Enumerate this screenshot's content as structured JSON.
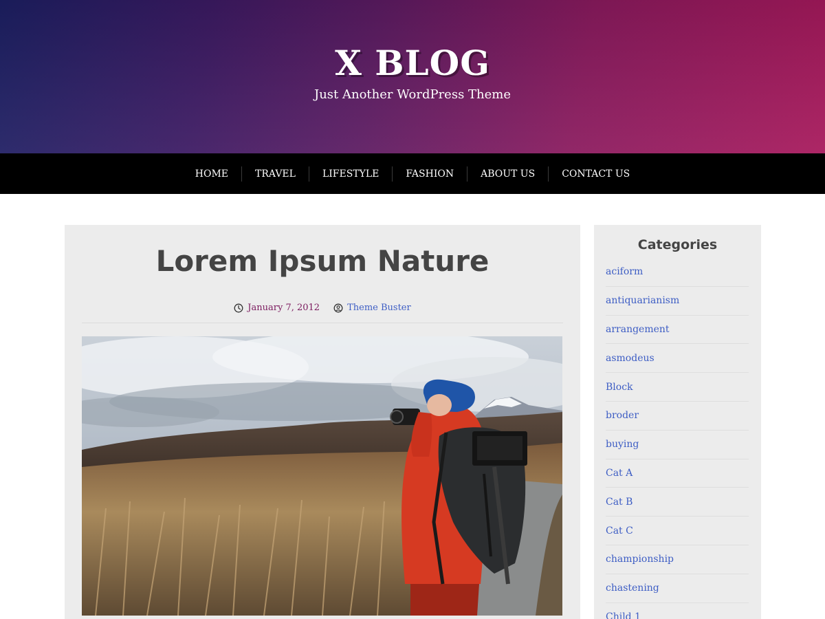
{
  "header": {
    "site_title": "X BLOG",
    "tagline": "Just Another WordPress Theme"
  },
  "nav": {
    "items": [
      "HOME",
      "TRAVEL",
      "LIFESTYLE",
      "FASHION",
      "ABOUT US",
      "CONTACT US"
    ]
  },
  "post": {
    "title": "Lorem Ipsum Nature",
    "date": "January 7, 2012",
    "author": "Theme Buster",
    "date_icon": "clock-icon",
    "author_icon": "user-icon"
  },
  "sidebar": {
    "title": "Categories",
    "categories": [
      "aciform",
      "antiquarianism",
      "arrangement",
      "asmodeus",
      "Block",
      "broder",
      "buying",
      "Cat A",
      "Cat B",
      "Cat C",
      "championship",
      "chastening",
      "Child 1"
    ]
  },
  "colors": {
    "header_gradient_start": "#1c1f63",
    "header_gradient_end": "#a8195c",
    "nav_background": "#000000",
    "link_blue": "#3d5dc4",
    "date_purple": "#7b1a5e",
    "panel_background": "#ececec"
  }
}
